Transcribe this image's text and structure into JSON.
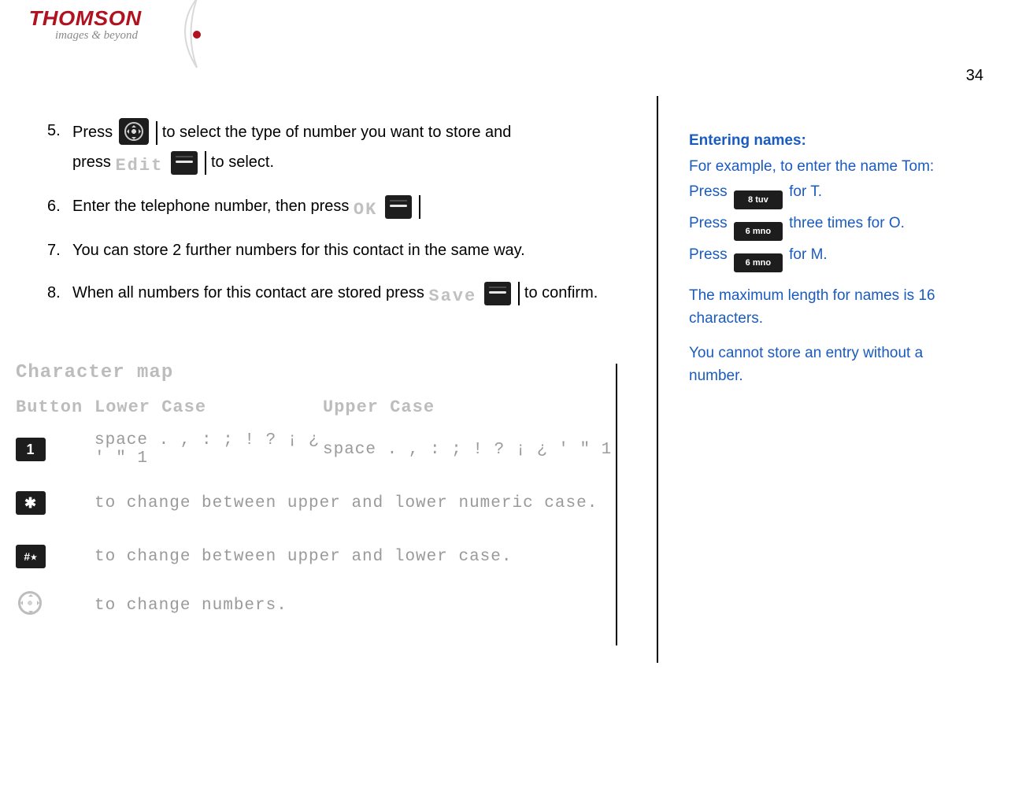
{
  "page_number": "34",
  "logo": {
    "brand": "THOMSON",
    "tagline": "images & beyond"
  },
  "steps": {
    "5": {
      "num": "5.",
      "text_a": "Press ",
      "text_b": " to select the type of number you want to store and",
      "text_c": "press ",
      "soft_label": "Edit",
      "text_d": " to select."
    },
    "6": {
      "num": "6.",
      "text_a": "Enter the telephone number, then press ",
      "soft_label": "OK"
    },
    "7": {
      "num": "7.",
      "text": "You can store 2 further numbers for this contact in the same way."
    },
    "8": {
      "num": "8.",
      "text_a": "When all numbers for this contact are stored press  ",
      "soft_label": "Save",
      "text_b": " to confirm."
    }
  },
  "sidebar": {
    "title": "Entering names:",
    "line1": "For example, to enter the name Tom:",
    "press": "Press ",
    "key8": "8 tuv",
    "forT": " for T.",
    "key6": "6 mno",
    "forO": " three times for O.",
    "forM": " for M.",
    "max": "The maximum length for names is 16 characters.",
    "note": "You cannot store an entry  without a number."
  },
  "charmap": {
    "title": "Character map",
    "header": {
      "button": "Button",
      "lower": "Lower Case",
      "upper": "Upper Case"
    },
    "row1": {
      "button_label": "1",
      "lower": "space . , : ; ! ? ¡ ¿ ' \" 1",
      "upper": "space . , : ; ! ? ¡ ¿ ' \" 1"
    },
    "row_star": {
      "button_label": "✱",
      "desc": "to change between upper and lower numeric case."
    },
    "row_hash": {
      "button_label": "#⭑",
      "desc": "to change between upper and lower case."
    },
    "row_nav": {
      "desc": "to change numbers."
    }
  }
}
